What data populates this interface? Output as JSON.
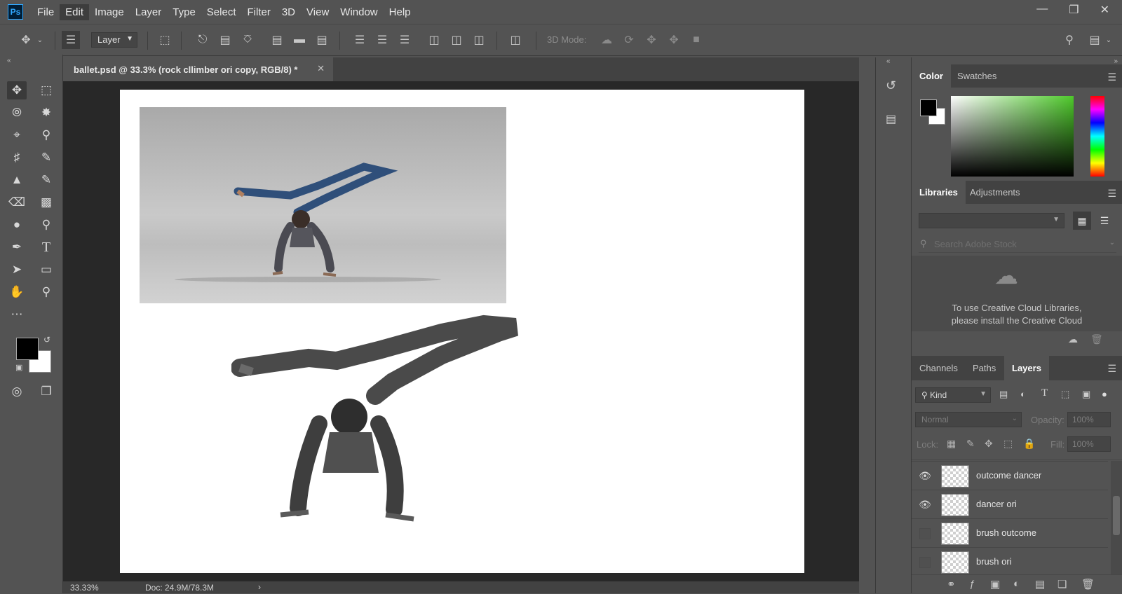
{
  "app": {
    "logo": "Ps"
  },
  "menu": [
    "File",
    "Edit",
    "Image",
    "Layer",
    "Type",
    "Select",
    "Filter",
    "3D",
    "View",
    "Window",
    "Help"
  ],
  "options": {
    "layer_select": "Layer",
    "mode_3d_label": "3D Mode:"
  },
  "document": {
    "tab_title": "ballet.psd @ 33.3% (rock cllimber ori copy, RGB/8) *",
    "zoom": "33.33%",
    "doc_size": "Doc: 24.9M/78.3M"
  },
  "color_panel": {
    "tabs": [
      "Color",
      "Swatches"
    ],
    "active": "Color",
    "foreground": "#000000",
    "background": "#ffffff"
  },
  "libraries_panel": {
    "tabs": [
      "Libraries",
      "Adjustments"
    ],
    "active": "Libraries",
    "search_placeholder": "Search Adobe Stock",
    "message_line1": "To use Creative Cloud Libraries,",
    "message_line2": "please install the Creative Cloud"
  },
  "layers_panel": {
    "tabs": [
      "Channels",
      "Paths",
      "Layers"
    ],
    "active": "Layers",
    "filter_label": "Kind",
    "blend_mode": "Normal",
    "opacity_label": "Opacity:",
    "opacity_value": "100%",
    "lock_label": "Lock:",
    "fill_label": "Fill:",
    "fill_value": "100%",
    "layers": [
      {
        "name": "outcome dancer",
        "visible": true
      },
      {
        "name": "dancer ori",
        "visible": true
      },
      {
        "name": "brush outcome",
        "visible": false
      },
      {
        "name": "brush ori",
        "visible": false
      }
    ]
  }
}
